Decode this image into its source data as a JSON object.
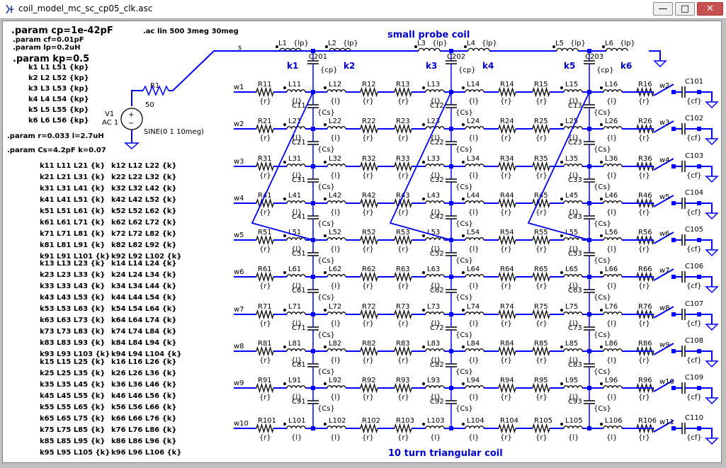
{
  "window": {
    "title": "coil_model_mc_sc_cp05_clk.asc",
    "minimize_glyph": "—",
    "maximize_glyph": "□",
    "close_glyph": "✕",
    "colors": {
      "wire": "#0000ff",
      "text": "#000000",
      "annotation": "#0000cd",
      "canvas": "#ffffff"
    }
  },
  "directives": {
    "cp": ".param cp=1e-42pF",
    "cf": ".param cf=0.01pF",
    "lp": ".param lp=0.2uH",
    "kp": ".param  kp=0.5",
    "ac": ".ac lin 500 3meg 30meg",
    "rl": ".param r=0.033  l=2.7uH",
    "csk": ".param Cs=4.2pF  k=0.07",
    "probe_couplings": [
      "k1 L1 L51 {kp}",
      "k2 L2 L52 {kp}",
      "k3 L3 L53 {kp}",
      "k4 L4 L54 {kp}",
      "k5 L5 L55 {kp}",
      "k6 L6 L56 {kp}"
    ],
    "couplings_left": [
      [
        "k11 L11 L21 {k}",
        "k21 L21 L31 {k}",
        "k31 L31 L41 {k}",
        "k41 L41 L51 {k}",
        "k51 L51 L61 {k}",
        "k61 L61 L71 {k}",
        "k71 L71 L81 {k}",
        "k81 L81 L91 {k}",
        "k91 L91 L101 {k}"
      ],
      [
        "k13 L13 L23 {k}",
        "k23 L23 L33 {k}",
        "k33 L33 L43 {k}",
        "k43 L43 L53 {k}",
        "k53 L53 L63 {k}",
        "k63 L63 L73 {k}",
        "k73 L73 L83 {k}",
        "k83 L83 L93 {k}",
        "k93 L93 L103 {k}"
      ],
      [
        "k15 L15 L25 {k}",
        "k25 L25 L35 {k}",
        "k35 L35 L45 {k}",
        "k45 L45 L55 {k}",
        "k55 L55 L65 {k}",
        "k65 L65 L75 {k}",
        "k75 L75 L85 {k}",
        "k85 L85 L95 {k}",
        "k95 L95 L105 {k}"
      ]
    ],
    "couplings_right": [
      [
        "k12 L12 L22 {k}",
        "k22 L22 L32 {k}",
        "k32 L32 L42 {k}",
        "k42 L42 L52 {k}",
        "k52 L52 L62 {k}",
        "k62 L62 L72 {k}",
        "k72 L72 L82 {k}",
        "k82 L82 L92 {k}",
        "k92 L92 L102 {k}"
      ],
      [
        "k14 L14 L24 {k}",
        "k24 L24 L34 {k}",
        "k34 L34 L44 {k}",
        "k44 L44 L54 {k}",
        "k54 L54 L64 {k}",
        "k64 L64 L74 {k}",
        "k74 L74 L84 {k}",
        "k84 L84 L94 {k}",
        "k94 L94 L104 {k}"
      ],
      [
        "k16 L16 L26 {k}",
        "k26 L26 L36 {k}",
        "k36 L36 L46 {k}",
        "k46 L46 L56 {k}",
        "k56 L56 L66 {k}",
        "k66 L66 L76 {k}",
        "k76 L76 L86 {k}",
        "k86 L86 L96 {k}",
        "k96 L96 L106 {k}"
      ]
    ]
  },
  "source": {
    "r1": "R1",
    "r1_value": "50",
    "v1": "V1",
    "v1_ac": "AC 1",
    "v1_sine": "SINE(0 1 10meg)"
  },
  "probe": {
    "title": "small probe coil",
    "net_s": "s",
    "inductors": [
      "L1",
      "L2",
      "L3",
      "L4",
      "L5",
      "L6"
    ],
    "inductor_value": "{lp}",
    "coupling_labels": [
      "k1",
      "k2",
      "k3",
      "k4",
      "k5",
      "k6"
    ],
    "caps": [
      "C201",
      "C202",
      "C203"
    ],
    "cap_value": "{cp}"
  },
  "coil": {
    "title": "10 turn triangular coil",
    "in_nets": [
      "w1",
      "w2",
      "w3",
      "w4",
      "w5",
      "w6",
      "w7",
      "w8",
      "w9",
      "w10"
    ],
    "out_nets": [
      "w2",
      "w3",
      "w4",
      "w5",
      "w6",
      "w7",
      "w8",
      "w9",
      "w10",
      "w11"
    ],
    "out_caps": [
      "C101",
      "C102",
      "C103",
      "C104",
      "C105",
      "C106",
      "C107",
      "C108",
      "C109",
      "C110"
    ],
    "out_cap_value": "{cf}",
    "r_value": "{r}",
    "l_value": "{l}",
    "cs_value": "{Cs}"
  }
}
